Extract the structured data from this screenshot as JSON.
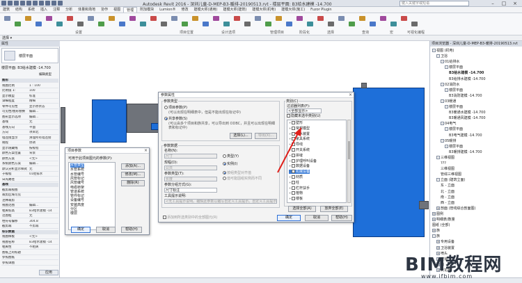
{
  "app": {
    "title": "Autodesk Revit 2016 -  深圳儿童-D-MEP-B3-暖排-20190513.rvt - 楼层平面: B3给水建模 -14.700",
    "search_placeholder": "键入关键字或短语"
  },
  "menu": {
    "tabs": [
      "建筑",
      "结构",
      "系统",
      "插入",
      "注释",
      "分析",
      "体量和场地",
      "协作",
      "视图",
      "管理",
      "附加模块",
      "Lumion®",
      "修改",
      "建模大师(通用)",
      "建模大师(建筑)",
      "建模大师(机电)",
      "建模大师(施工)",
      "Fuzor Plugin"
    ],
    "active_index": 9
  },
  "ribbon": {
    "groups": [
      "设置",
      "项目位置",
      "设计选项",
      "管理项目",
      "阶段化",
      "选择",
      "查询",
      "宏",
      "可视化编程"
    ]
  },
  "option_bar": {
    "label": "选择 ▾"
  },
  "properties": {
    "title": "属性",
    "type_name": "楼层平面",
    "filter_label": "楼层平面: B3给水建模 -14.700",
    "edit_type": "编辑类型",
    "rows": [
      {
        "k": "图形",
        "v": "",
        "section": true
      },
      {
        "k": "视图比例",
        "v": "1 : 100"
      },
      {
        "k": "比例值 1:",
        "v": "100"
      },
      {
        "k": "显示模型",
        "v": "标准"
      },
      {
        "k": "详细程度",
        "v": "精细"
      },
      {
        "k": "零件可见性",
        "v": "显示原状态"
      },
      {
        "k": "可见性/图形替换",
        "v": "编辑..."
      },
      {
        "k": "图形显示选项",
        "v": "编辑..."
      },
      {
        "k": "基线",
        "v": "无"
      },
      {
        "k": "基线方向",
        "v": "平面"
      },
      {
        "k": "方向",
        "v": "项目北"
      },
      {
        "k": "墙连接显示",
        "v": "清理所有墙连接"
      },
      {
        "k": "规程",
        "v": "协调"
      },
      {
        "k": "显示隐藏线",
        "v": "按规程"
      },
      {
        "k": "颜色方案位置",
        "v": "背景"
      },
      {
        "k": "颜色方案",
        "v": "<无>"
      },
      {
        "k": "系统颜色方案",
        "v": "编辑..."
      },
      {
        "k": "默认分析显示样式",
        "v": "无"
      },
      {
        "k": "子规程",
        "v": "01给排水"
      },
      {
        "k": "日光路径",
        "v": ""
      },
      {
        "k": "基线",
        "v": "",
        "section": true
      },
      {
        "k": "截剪裁视图",
        "v": ""
      },
      {
        "k": "裁剪区域可见",
        "v": ""
      },
      {
        "k": "注释裁剪",
        "v": ""
      },
      {
        "k": "视图范围",
        "v": "编辑..."
      },
      {
        "k": "相关标高",
        "v": "B3给水建模 -14"
      },
      {
        "k": "范围框",
        "v": "无"
      },
      {
        "k": "柱符号偏移",
        "v": "304.8"
      },
      {
        "k": "截剪裁",
        "v": "不剪裁"
      },
      {
        "k": "标识数据",
        "v": "",
        "section": true
      },
      {
        "k": "视图样板",
        "v": "<无>"
      },
      {
        "k": "视图名称",
        "v": "B3给水建模 -14"
      },
      {
        "k": "相关性",
        "v": "不相关"
      },
      {
        "k": "图纸上的标题",
        "v": ""
      },
      {
        "k": "参照图纸",
        "v": ""
      },
      {
        "k": "参照详图",
        "v": ""
      }
    ],
    "apply_label": "应用"
  },
  "browser": {
    "title": "项目浏览器 - 深圳儿童-D-MEP-B3-暖排-20190513.rvt",
    "items": [
      {
        "depth": 0,
        "toggle": "-",
        "label": "视图 (机电)"
      },
      {
        "depth": 1,
        "toggle": "-",
        "label": "卫浴"
      },
      {
        "depth": 2,
        "toggle": "-",
        "label": "01给排水"
      },
      {
        "depth": 3,
        "toggle": "-",
        "label": "楼层平面"
      },
      {
        "depth": 4,
        "toggle": "",
        "label": "B3给水建模 -14.700",
        "bold": true
      },
      {
        "depth": 4,
        "toggle": "",
        "label": "B3给排水建模 -14.700"
      },
      {
        "depth": 2,
        "toggle": "-",
        "label": "02消防水"
      },
      {
        "depth": 3,
        "toggle": "-",
        "label": "楼层平面"
      },
      {
        "depth": 4,
        "toggle": "",
        "label": "B3消防建模 -14.700"
      },
      {
        "depth": 2,
        "toggle": "-",
        "label": "03暖通"
      },
      {
        "depth": 3,
        "toggle": "-",
        "label": "楼层平面"
      },
      {
        "depth": 4,
        "toggle": "",
        "label": "B3暖通水建模 -14.700"
      },
      {
        "depth": 4,
        "toggle": "",
        "label": "B3暖通风建模 -14.700"
      },
      {
        "depth": 2,
        "toggle": "-",
        "label": "04电气"
      },
      {
        "depth": 3,
        "toggle": "-",
        "label": "楼层平面"
      },
      {
        "depth": 4,
        "toggle": "",
        "label": "B3电气建模 -14.700"
      },
      {
        "depth": 2,
        "toggle": "-",
        "label": "05暖排"
      },
      {
        "depth": 3,
        "toggle": "-",
        "label": "楼层平面"
      },
      {
        "depth": 4,
        "toggle": "",
        "label": "B3暖排建模 -14.700"
      },
      {
        "depth": 1,
        "toggle": "-",
        "label": "三维视图"
      },
      {
        "depth": 2,
        "toggle": "",
        "label": "???"
      },
      {
        "depth": 2,
        "toggle": "",
        "label": "三维视图"
      },
      {
        "depth": 2,
        "toggle": "",
        "label": "管综三维视图"
      },
      {
        "depth": 1,
        "toggle": "-",
        "label": "立面 (建筑立面)"
      },
      {
        "depth": 2,
        "toggle": "",
        "label": "东 - 立面"
      },
      {
        "depth": 2,
        "toggle": "",
        "label": "北 - 立面"
      },
      {
        "depth": 2,
        "toggle": "",
        "label": "南 - 立面"
      },
      {
        "depth": 2,
        "toggle": "",
        "label": "西 - 立面"
      },
      {
        "depth": 1,
        "toggle": "+",
        "label": "剖面 (管线综合剖面图)"
      },
      {
        "depth": 0,
        "toggle": "+",
        "label": "图例"
      },
      {
        "depth": 0,
        "toggle": "+",
        "label": "明细表/数量"
      },
      {
        "depth": 0,
        "toggle": "",
        "label": "图纸 (全部)"
      },
      {
        "depth": 0,
        "toggle": "+",
        "label": "族"
      },
      {
        "depth": 0,
        "toggle": "-",
        "label": "族"
      },
      {
        "depth": 1,
        "toggle": "+",
        "label": "专用设备"
      },
      {
        "depth": 1,
        "toggle": "+",
        "label": "卫浴装置"
      },
      {
        "depth": 1,
        "toggle": "+",
        "label": "喷头"
      },
      {
        "depth": 1,
        "toggle": "+",
        "label": "坡道"
      },
      {
        "depth": 1,
        "toggle": "+",
        "label": "墙"
      },
      {
        "depth": 1,
        "toggle": "+",
        "label": "天花板"
      }
    ]
  },
  "project_params_dialog": {
    "title": "项目参数",
    "hint": "可用于此项目图元的参数(P):",
    "params": [
      "水管类型",
      "水管系统",
      "水管编号",
      "风管标记",
      "风管编号",
      "电缆桥架",
      "管道系统",
      "管件标记",
      "设备编号",
      "安装高度",
      "分区",
      "楼层"
    ],
    "buttons": [
      "添加(A)...",
      "修改(M)...",
      "删除(R)"
    ],
    "footer": [
      "确定",
      "取消",
      "帮助(H)"
    ]
  },
  "param_props_dialog": {
    "title": "参数属性",
    "param_type_label": "参数类型",
    "project_param_label": "项目参数(P)",
    "project_param_desc": "(可以出现在明细表中，但是不能出现在标记中)",
    "shared_param_label": "共享参数(S)",
    "shared_param_desc": "(可以由多个项目和族共享，可以导出到 ODBC，并且可以出现在明细表和标记中)",
    "select_btn": "选择(L)...",
    "export_btn": "导出(X)...",
    "param_data_label": "参数数据",
    "name_label": "名称(N):",
    "name_value": "尺寸",
    "type_radio": "类型(Y)",
    "instance_radio": "实例(I)",
    "discipline_label": "规程(D):",
    "discipline_value": "公共",
    "param_type_field_label": "参数类型(T):",
    "param_type_value": "长度",
    "group_label": "参数分组方式(G):",
    "group_value": "尺寸标注",
    "by_group_value": "按组类型对齐值",
    "by_group_instance": "值可能因组实例而不同",
    "tooltip_label": "工具提示说明:",
    "tooltip_value": "<无工具提示说明。编辑此参数以编写自定义工具提示。自定义工具提示限为 250...",
    "add_to_all": "添加到所选类别中的全部图元(R)",
    "category_label": "类别(C)",
    "filter_list_label": "过滤器列表(F):",
    "filter_value": "<全部显示>",
    "hide_unchecked": "隐藏未选中类别(U)",
    "categories": [
      {
        "label": "壁形",
        "checked": false
      },
      {
        "label": "常规模型",
        "checked": false
      },
      {
        "label": "喷水装置",
        "checked": false
      },
      {
        "label": "家具系统",
        "checked": false
      },
      {
        "label": "导线",
        "checked": false
      },
      {
        "label": "开关系统",
        "checked": false
      },
      {
        "label": "拼缝",
        "checked": false
      },
      {
        "label": "护理呼叫设备",
        "checked": false
      },
      {
        "label": "数据设备",
        "checked": false
      },
      {
        "label": "机械设备",
        "checked": true,
        "selected": true
      },
      {
        "label": "材质",
        "checked": false
      },
      {
        "label": "柱",
        "checked": false
      },
      {
        "label": "栏杆扶手",
        "checked": false
      },
      {
        "label": "植物",
        "checked": false
      },
      {
        "label": "楼板",
        "checked": false
      }
    ],
    "select_all": "选择全部(A)",
    "deselect_all": "放弃全部(E)",
    "footer": [
      "确定",
      "取消",
      "帮助(H)"
    ]
  },
  "watermark": {
    "main": "BIM教程网",
    "url": "www.ifbim.com"
  },
  "colors": {
    "equipment_blue": "#1e6fd9",
    "selection_blue": "#3b7dd8",
    "arrow_red": "#e0201b"
  }
}
